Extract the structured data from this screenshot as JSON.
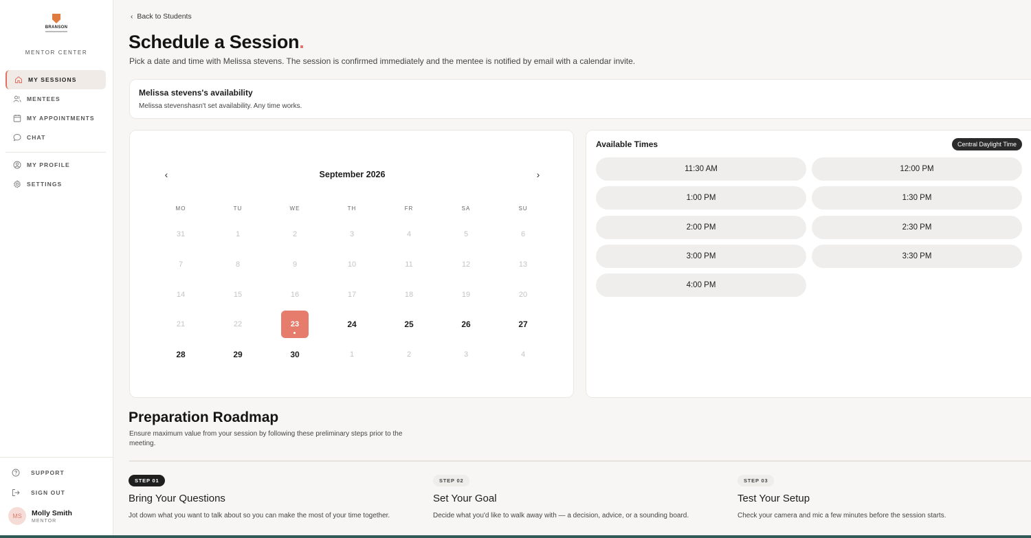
{
  "sidebar": {
    "brand": "BRANSON",
    "center_label": "MENTOR CENTER",
    "items": [
      {
        "label": "MY SESSIONS",
        "icon": "home-icon",
        "active": true
      },
      {
        "label": "MENTEES",
        "icon": "users-icon",
        "active": false
      },
      {
        "label": "MY APPOINTMENTS",
        "icon": "calendar-icon",
        "active": false
      },
      {
        "label": "CHAT",
        "icon": "chat-icon",
        "active": false
      },
      {
        "label": "MY PROFILE",
        "icon": "profile-icon",
        "active": false
      },
      {
        "label": "SETTINGS",
        "icon": "gear-icon",
        "active": false
      }
    ],
    "support_label": "SUPPORT",
    "signout_label": "SIGN OUT",
    "user": {
      "initials": "MS",
      "name": "Molly Smith",
      "role": "MENTOR"
    }
  },
  "header": {
    "back_label": "Back to Students",
    "title": "Schedule a Session",
    "title_dot": ".",
    "subtitle": "Pick a date and time with Melissa stevens. The session is confirmed immediately and the mentee is notified by email with a calendar invite."
  },
  "availability": {
    "title": "Melissa stevens's availability",
    "text": "Melissa stevenshasn't set availability. Any time works."
  },
  "calendar": {
    "month": "September 2026",
    "weekdays": [
      "MO",
      "TU",
      "WE",
      "TH",
      "FR",
      "SA",
      "SU"
    ],
    "weeks": [
      [
        "31",
        "1",
        "2",
        "3",
        "4",
        "5",
        "6"
      ],
      [
        "7",
        "8",
        "9",
        "10",
        "11",
        "12",
        "13"
      ],
      [
        "14",
        "15",
        "16",
        "17",
        "18",
        "19",
        "20"
      ],
      [
        "21",
        "22",
        "23",
        "24",
        "25",
        "26",
        "27"
      ],
      [
        "28",
        "29",
        "30",
        "1",
        "2",
        "3",
        "4"
      ]
    ],
    "available_days": [
      "23",
      "24",
      "25",
      "26",
      "27",
      "28",
      "29",
      "30"
    ],
    "selected_day": "23"
  },
  "times": {
    "title": "Available Times",
    "timezone": "Central Daylight Time",
    "slots": [
      "11:30 AM",
      "12:00 PM",
      "1:00 PM",
      "1:30 PM",
      "2:00 PM",
      "2:30 PM",
      "3:00 PM",
      "3:30 PM",
      "4:00 PM"
    ]
  },
  "roadmap": {
    "title": "Preparation Roadmap",
    "desc": "Ensure maximum value from your session by following these preliminary steps prior to the meeting.",
    "steps": [
      {
        "badge": "STEP 01",
        "title": "Bring Your Questions",
        "desc": "Jot down what you want to talk about so you can make the most of your time together."
      },
      {
        "badge": "STEP 02",
        "title": "Set Your Goal",
        "desc": "Decide what you'd like to walk away with — a decision, advice, or a sounding board."
      },
      {
        "badge": "STEP 03",
        "title": "Test Your Setup",
        "desc": "Check your camera and mic a few minutes before the session starts."
      }
    ]
  },
  "colors": {
    "accent": "#e67c6c",
    "dark": "#1f1f1f",
    "sidebar_active": "#f0ebe6"
  }
}
